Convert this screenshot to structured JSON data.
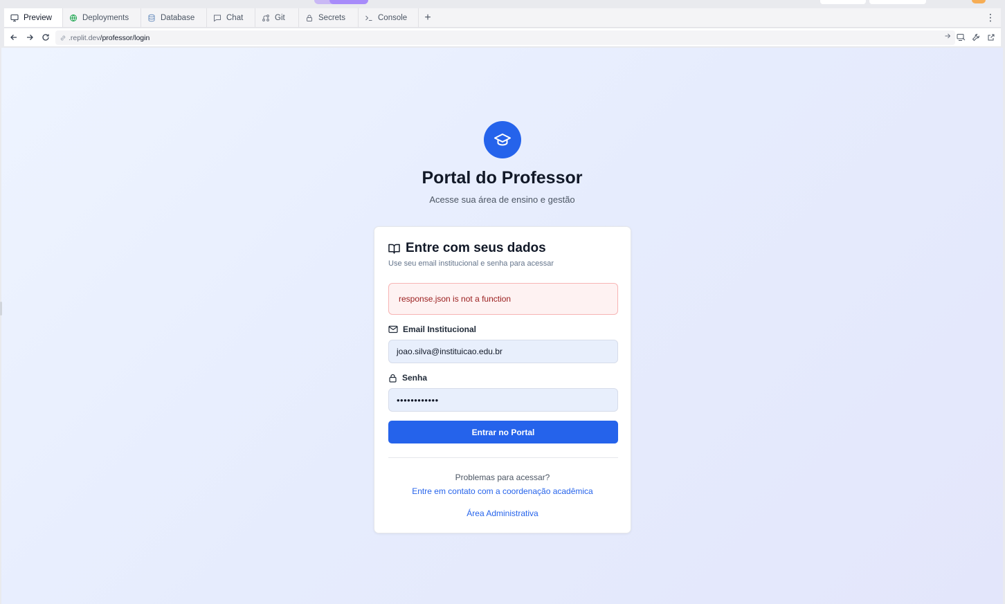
{
  "tabs": [
    {
      "label": "Preview",
      "icon": "monitor-icon",
      "active": true
    },
    {
      "label": "Deployments",
      "icon": "globe-icon",
      "active": false
    },
    {
      "label": "Database",
      "icon": "database-icon",
      "active": false
    },
    {
      "label": "Chat",
      "icon": "chat-icon",
      "active": false
    },
    {
      "label": "Git",
      "icon": "git-icon",
      "active": false
    },
    {
      "label": "Secrets",
      "icon": "lock-icon",
      "active": false
    },
    {
      "label": "Console",
      "icon": "terminal-icon",
      "active": false
    }
  ],
  "tab_add": "+",
  "tab_menu": "⋮",
  "url": {
    "host": ".replit.dev",
    "path": "/professor/login"
  },
  "page": {
    "title": "Portal do Professor",
    "subtitle": "Acesse sua área de ensino e gestão"
  },
  "card": {
    "title": "Entre com seus dados",
    "description": "Use seu email institucional e senha para acessar",
    "error": "response.json is not a function",
    "email_label": "Email Institucional",
    "email_value": "joao.silva@instituicao.edu.br",
    "password_label": "Senha",
    "password_value": "••••••••••••",
    "submit": "Entrar no Portal",
    "help_question": "Problemas para acessar?",
    "help_link": "Entre em contato com a coordenação acadêmica",
    "admin_link": "Área Administrativa"
  },
  "colors": {
    "primary": "#2563eb",
    "error_bg": "#fef2f2",
    "error_text": "#991b1b",
    "input_bg": "#e8effc"
  }
}
